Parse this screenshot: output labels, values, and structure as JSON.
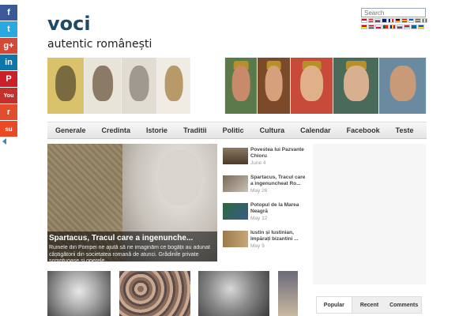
{
  "site": {
    "title": "voci",
    "tagline": "autentic românești"
  },
  "social": [
    {
      "icon": "facebook-icon",
      "glyph": "f",
      "color": "#3b5998"
    },
    {
      "icon": "twitter-icon",
      "glyph": "t",
      "color": "#29a9e0"
    },
    {
      "icon": "google-plus-icon",
      "glyph": "g+",
      "color": "#d34836"
    },
    {
      "icon": "linkedin-icon",
      "glyph": "in",
      "color": "#0e76a8"
    },
    {
      "icon": "pinterest-icon",
      "glyph": "P",
      "color": "#cb2027"
    },
    {
      "icon": "youtube-icon",
      "glyph": "You",
      "color": "#c4302b"
    },
    {
      "icon": "reddit-icon",
      "glyph": "r",
      "color": "#e24d2b"
    },
    {
      "icon": "stumbleupon-icon",
      "glyph": "su",
      "color": "#eb4924"
    }
  ],
  "search": {
    "placeholder": "Search"
  },
  "nav": {
    "items": [
      "Generale",
      "Credinta",
      "Istorie",
      "Traditii",
      "Politic",
      "Cultura",
      "Calendar",
      "Facebook",
      "Teste"
    ]
  },
  "featured": {
    "title": "Spartacus, Tracul care a ingenunche...",
    "excerpt": "Ruinele din Pompei ne ajută să ne imaginăm ce bogății au adunat câștigătorii din societatea romană de atunci. Grădinile private somptuoase și operele"
  },
  "posts": [
    {
      "title": "Povestea lui Pazvante Chioru",
      "date": "June 4"
    },
    {
      "title": "Spartacus, Tracul care a ingenuncheat Ro...",
      "date": "May 26"
    },
    {
      "title": "Potopul de la Marea Neagră",
      "date": "May 12"
    },
    {
      "title": "Iustin și Iustinian, împărați bizantini ...",
      "date": "May 9"
    }
  ],
  "sidebar_tabs": [
    "Popular",
    "Recent",
    "Comments"
  ],
  "colors": {
    "title": "#1f4a66",
    "nav_bg": "#ebebeb"
  }
}
